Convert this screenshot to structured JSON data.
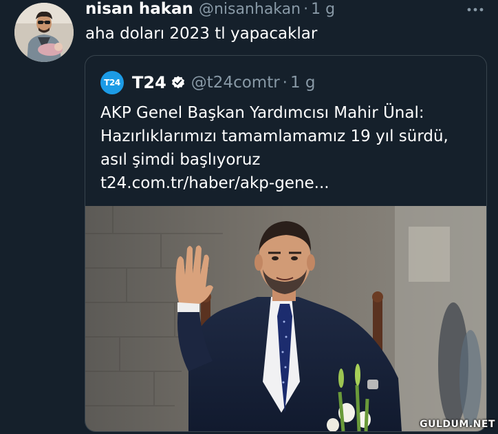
{
  "tweet": {
    "display_name": "nisan hakan",
    "handle": "@nisanhakan",
    "separator": "·",
    "time": "1 g",
    "text": "aha doları 2023 tl yapacaklar",
    "more_icon": "more-dots-icon"
  },
  "quoted_tweet": {
    "logo_text": "T24",
    "display_name": "T24",
    "verified_icon": "verified-badge-icon",
    "handle": "@t24comtr",
    "separator": "·",
    "time": "1 g",
    "text_lines": [
      "AKP Genel Başkan Yardımcısı Mahir Ünal:",
      "Hazırlıklarımızı tamamlamamız 19 yıl sürdü,",
      "asıl şimdi başlıyoruz",
      "t24.com.tr/haber/akp-gene..."
    ],
    "media": "photo-man-in-suit-waving"
  },
  "watermark": "GULDUM.NET",
  "colors": {
    "background": "#15202b",
    "secondary_text": "#8899a6",
    "border": "#38444d",
    "accent": "#1d9bf0"
  }
}
